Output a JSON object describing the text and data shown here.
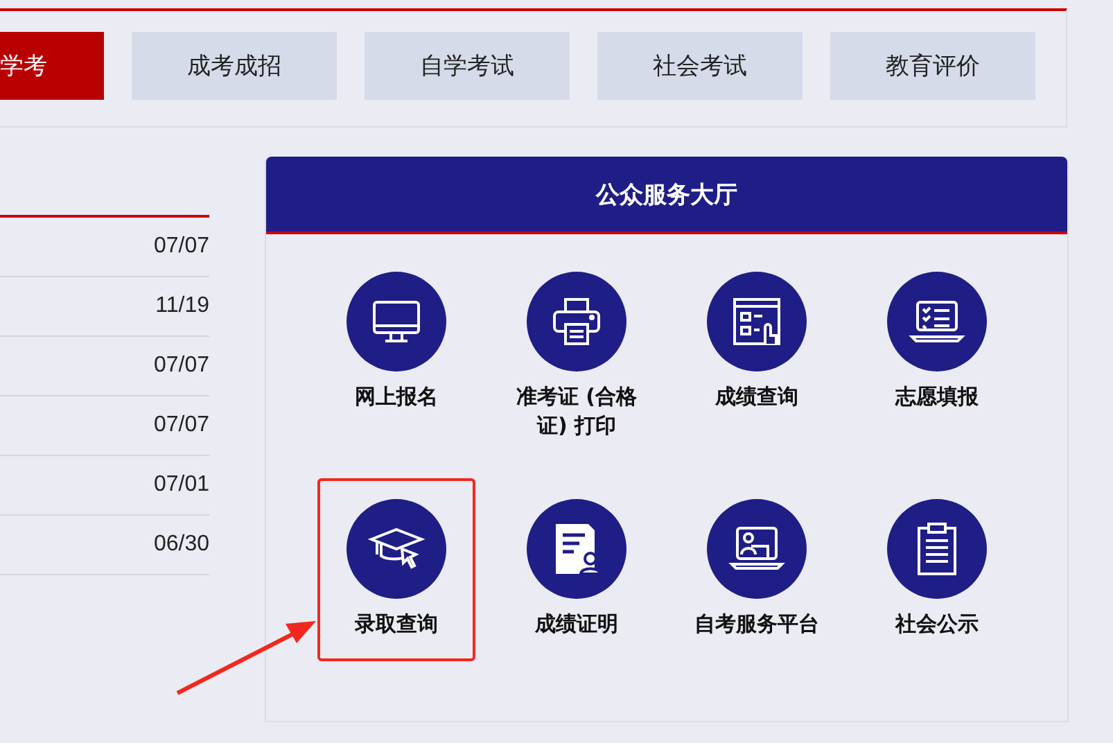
{
  "nav_tabs": [
    {
      "label": "学考",
      "selected": true
    },
    {
      "label": "成考成招",
      "selected": false
    },
    {
      "label": "自学考试",
      "selected": false
    },
    {
      "label": "社会考试",
      "selected": false
    },
    {
      "label": "教育评价",
      "selected": false
    }
  ],
  "news_list": {
    "rows": [
      {
        "date": "07/07"
      },
      {
        "date": "11/19"
      },
      {
        "date": "07/07"
      },
      {
        "date": "07/07"
      },
      {
        "date": "07/01"
      },
      {
        "date": "06/30"
      }
    ]
  },
  "service_hall": {
    "title": "公众服务大厅",
    "items": [
      {
        "label": "网上报名",
        "kind": "monitor",
        "highlighted": false
      },
      {
        "label": "准考证 (合格证) 打印",
        "kind": "printer",
        "highlighted": false
      },
      {
        "label": "成绩查询",
        "kind": "form",
        "highlighted": false
      },
      {
        "label": "志愿填报",
        "kind": "laptop-list",
        "highlighted": false
      },
      {
        "label": "录取查询",
        "kind": "cap",
        "highlighted": true
      },
      {
        "label": "成绩证明",
        "kind": "certificate",
        "highlighted": false
      },
      {
        "label": "自考服务平台",
        "kind": "laptop-person",
        "highlighted": false
      },
      {
        "label": "社会公示",
        "kind": "clipboard",
        "highlighted": false
      }
    ]
  }
}
